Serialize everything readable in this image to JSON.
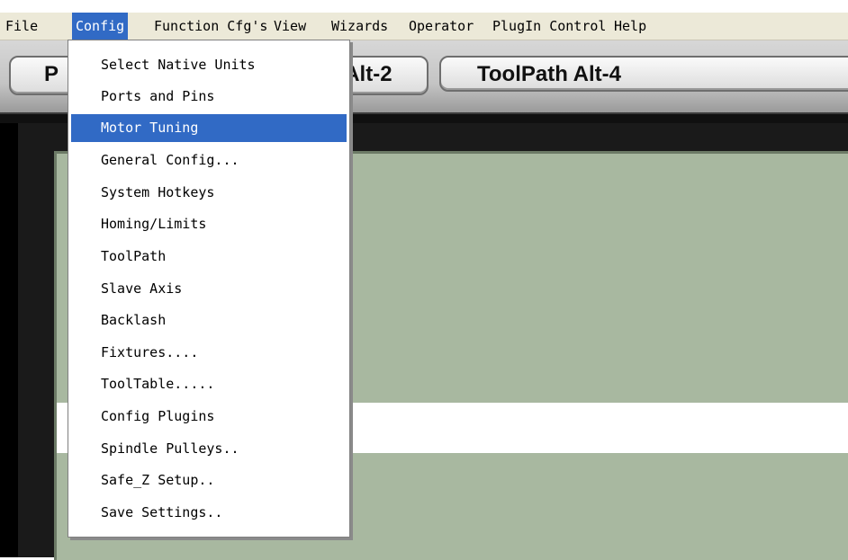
{
  "menubar": {
    "items": [
      {
        "label": "File"
      },
      {
        "label": "Config"
      },
      {
        "label": "Function Cfg's"
      },
      {
        "label": "View"
      },
      {
        "label": "Wizards"
      },
      {
        "label": "Operator"
      },
      {
        "label": "PlugIn Control"
      },
      {
        "label": "Help"
      }
    ],
    "active": "Config"
  },
  "toolbar": {
    "tabs": [
      {
        "label": "P"
      },
      {
        "label": "MDI Alt-2"
      },
      {
        "label": "ToolPath Alt-4"
      }
    ]
  },
  "config_menu": {
    "items": [
      {
        "label": "Select Native Units"
      },
      {
        "label": "Ports and Pins"
      },
      {
        "label": "Motor Tuning"
      },
      {
        "label": "General Config..."
      },
      {
        "label": "System Hotkeys"
      },
      {
        "label": "Homing/Limits"
      },
      {
        "label": "ToolPath"
      },
      {
        "label": "Slave Axis"
      },
      {
        "label": "Backlash"
      },
      {
        "label": "Fixtures...."
      },
      {
        "label": "ToolTable....."
      },
      {
        "label": "Config Plugins"
      },
      {
        "label": "Spindle Pulleys.."
      },
      {
        "label": "Safe_Z Setup.."
      },
      {
        "label": "Save Settings.."
      }
    ],
    "highlighted": "Motor Tuning"
  },
  "colors": {
    "menu_highlight": "#316ac5",
    "menubar_bg": "#ece9d8",
    "panel_bg": "#a8b8a0"
  }
}
